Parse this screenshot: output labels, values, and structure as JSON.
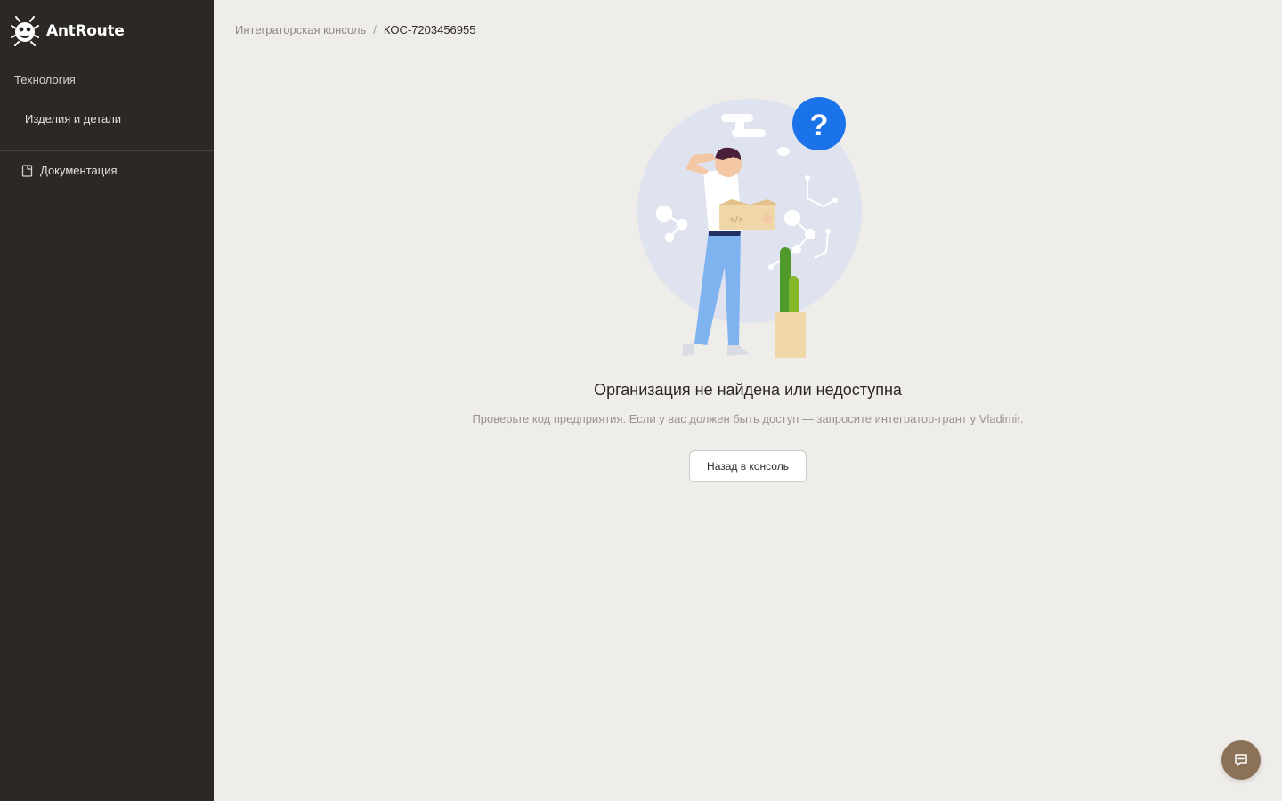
{
  "brand": {
    "name": "AntRoute"
  },
  "sidebar": {
    "section_label": "Технология",
    "items": [
      {
        "label": "Изделия и детали"
      }
    ],
    "docs": {
      "label": "Документация",
      "icon": "document-icon"
    }
  },
  "breadcrumb": {
    "parent": "Интеграторская консоль",
    "separator": "/",
    "current": "КОС-7203456955"
  },
  "empty_state": {
    "title": "Организация не найдена или недоступна",
    "description": "Проверьте код предприятия. Если у вас должен быть доступ — запросите интегратор-грант у Vladimir.",
    "button_label": "Назад в консоль",
    "question_mark": "?"
  },
  "chat": {
    "icon": "chat-bubble-icon"
  },
  "colors": {
    "sidebar_bg": "#2c2824",
    "page_bg": "#efedea",
    "accent_blue": "#1a73e8",
    "chat_button": "#8a7157"
  }
}
